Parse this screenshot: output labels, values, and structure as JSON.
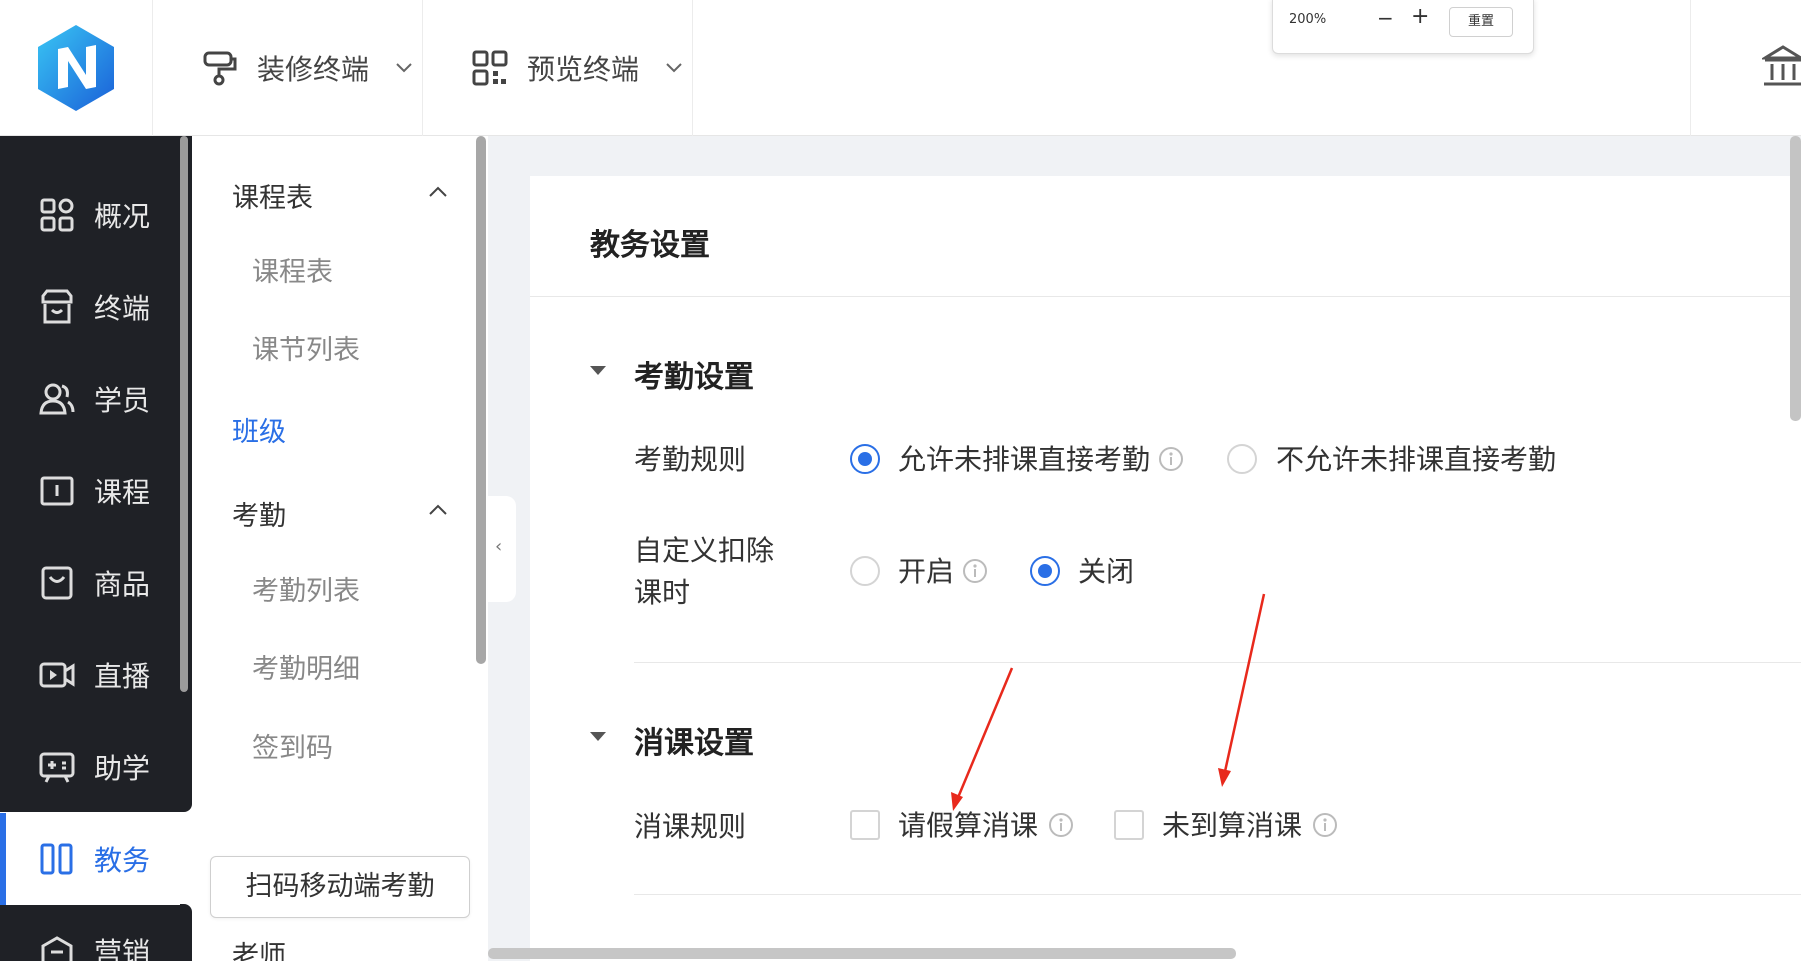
{
  "topbar": {
    "menus": [
      {
        "label": "装修终端",
        "icon": "paint-roller-icon"
      },
      {
        "label": "预览终端",
        "icon": "qr-code-icon"
      }
    ],
    "zoom": {
      "percent": "200%",
      "minus": "−",
      "plus": "+",
      "reset": "重置"
    }
  },
  "sidebar": {
    "items": [
      {
        "label": "概况",
        "icon": "dashboard-icon"
      },
      {
        "label": "终端",
        "icon": "store-icon"
      },
      {
        "label": "学员",
        "icon": "users-icon"
      },
      {
        "label": "课程",
        "icon": "book-icon"
      },
      {
        "label": "商品",
        "icon": "shopping-bag-icon"
      },
      {
        "label": "直播",
        "icon": "video-icon"
      },
      {
        "label": "助学",
        "icon": "assist-icon"
      },
      {
        "label": "教务",
        "icon": "columns-icon",
        "active": true
      },
      {
        "label": "营销",
        "icon": "marketing-icon"
      }
    ]
  },
  "subnav": {
    "group1": "课程表",
    "group1_items": [
      "课程表",
      "课节列表"
    ],
    "active_item": "班级",
    "group2": "考勤",
    "group2_items": [
      "考勤列表",
      "考勤明细",
      "签到码"
    ],
    "scan_button": "扫码移动端考勤",
    "teacher": "老师",
    "collapse_glyph": "‹"
  },
  "main": {
    "title": "教务设置",
    "attendance": {
      "section_title": "考勤设置",
      "rule_label": "考勤规则",
      "rule_options": [
        "允许未排课直接考勤",
        "不允许未排课直接考勤"
      ],
      "rule_selected": 0,
      "deduct_label_line1": "自定义扣除",
      "deduct_label_line2": "课时",
      "deduct_options": [
        "开启",
        "关闭"
      ],
      "deduct_selected": 1
    },
    "consume": {
      "section_title": "消课设置",
      "rule_label": "消课规则",
      "options": [
        "请假算消课",
        "未到算消课"
      ],
      "checked": [
        false,
        false
      ]
    }
  },
  "colors": {
    "accent": "#2a6fe6",
    "sidebar_bg": "#1f2126",
    "annotation": "#e8291c"
  }
}
